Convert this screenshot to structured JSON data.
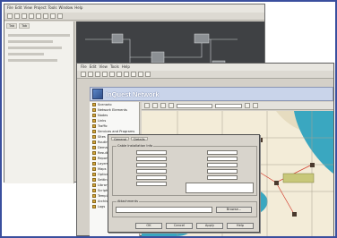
{
  "back_window": {
    "menu_items": [
      "File",
      "Edit",
      "View",
      "Project",
      "Tools",
      "Window",
      "Help"
    ],
    "left_panel_tabs": [
      "Tab",
      "Tab"
    ]
  },
  "mid_window": {
    "app_title": "InQuest Network",
    "menu_items": [
      "File",
      "Edit",
      "View",
      "Tools",
      "Help"
    ],
    "tree_items": [
      "Scenario",
      "Network Elements",
      "Nodes",
      "Links",
      "Traffic",
      "Services and Programs",
      "Sites",
      "Routing",
      "Demand",
      "Results",
      "Reports",
      "Layers",
      "Maps",
      "Options",
      "Settings",
      "Library",
      "Scripts",
      "Templates",
      "Archive",
      "Logs"
    ]
  },
  "dialog": {
    "tabs": [
      "General",
      "Details"
    ],
    "group_title": "Cable Installation Info",
    "bottom_group_title": "Attachments",
    "browse_label": "Browse...",
    "buttons": [
      "OK",
      "Cancel",
      "Apply",
      "Help"
    ]
  },
  "colors": {
    "frame_border": "#3a4f9e",
    "title_bar": "#c9d4ea",
    "canvas_bg": "#3f4144",
    "water": "#3aa7c0",
    "map_land": "#f3ecd8",
    "highlight": "#c8c87a"
  }
}
